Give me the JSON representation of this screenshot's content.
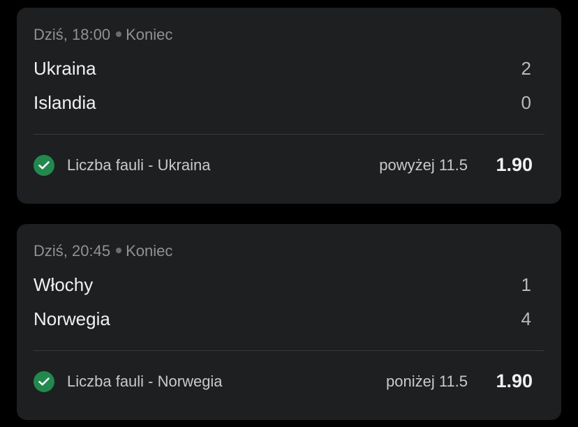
{
  "matches": [
    {
      "time": "Dziś, 18:00",
      "status": "Koniec",
      "home": {
        "name": "Ukraina",
        "score": "2"
      },
      "away": {
        "name": "Islandia",
        "score": "0"
      },
      "bet": {
        "market": "Liczba fauli - Ukraina",
        "pick": "powyżej 11.5",
        "odds": "1.90",
        "result_icon": "check-circle-icon"
      }
    },
    {
      "time": "Dziś, 20:45",
      "status": "Koniec",
      "home": {
        "name": "Włochy",
        "score": "1"
      },
      "away": {
        "name": "Norwegia",
        "score": "4"
      },
      "bet": {
        "market": "Liczba fauli - Norwegia",
        "pick": "poniżej 11.5",
        "odds": "1.90",
        "result_icon": "check-circle-icon"
      }
    }
  ],
  "colors": {
    "background": "#000000",
    "card": "#1e1f21",
    "win_green": "#1f8a4c"
  }
}
